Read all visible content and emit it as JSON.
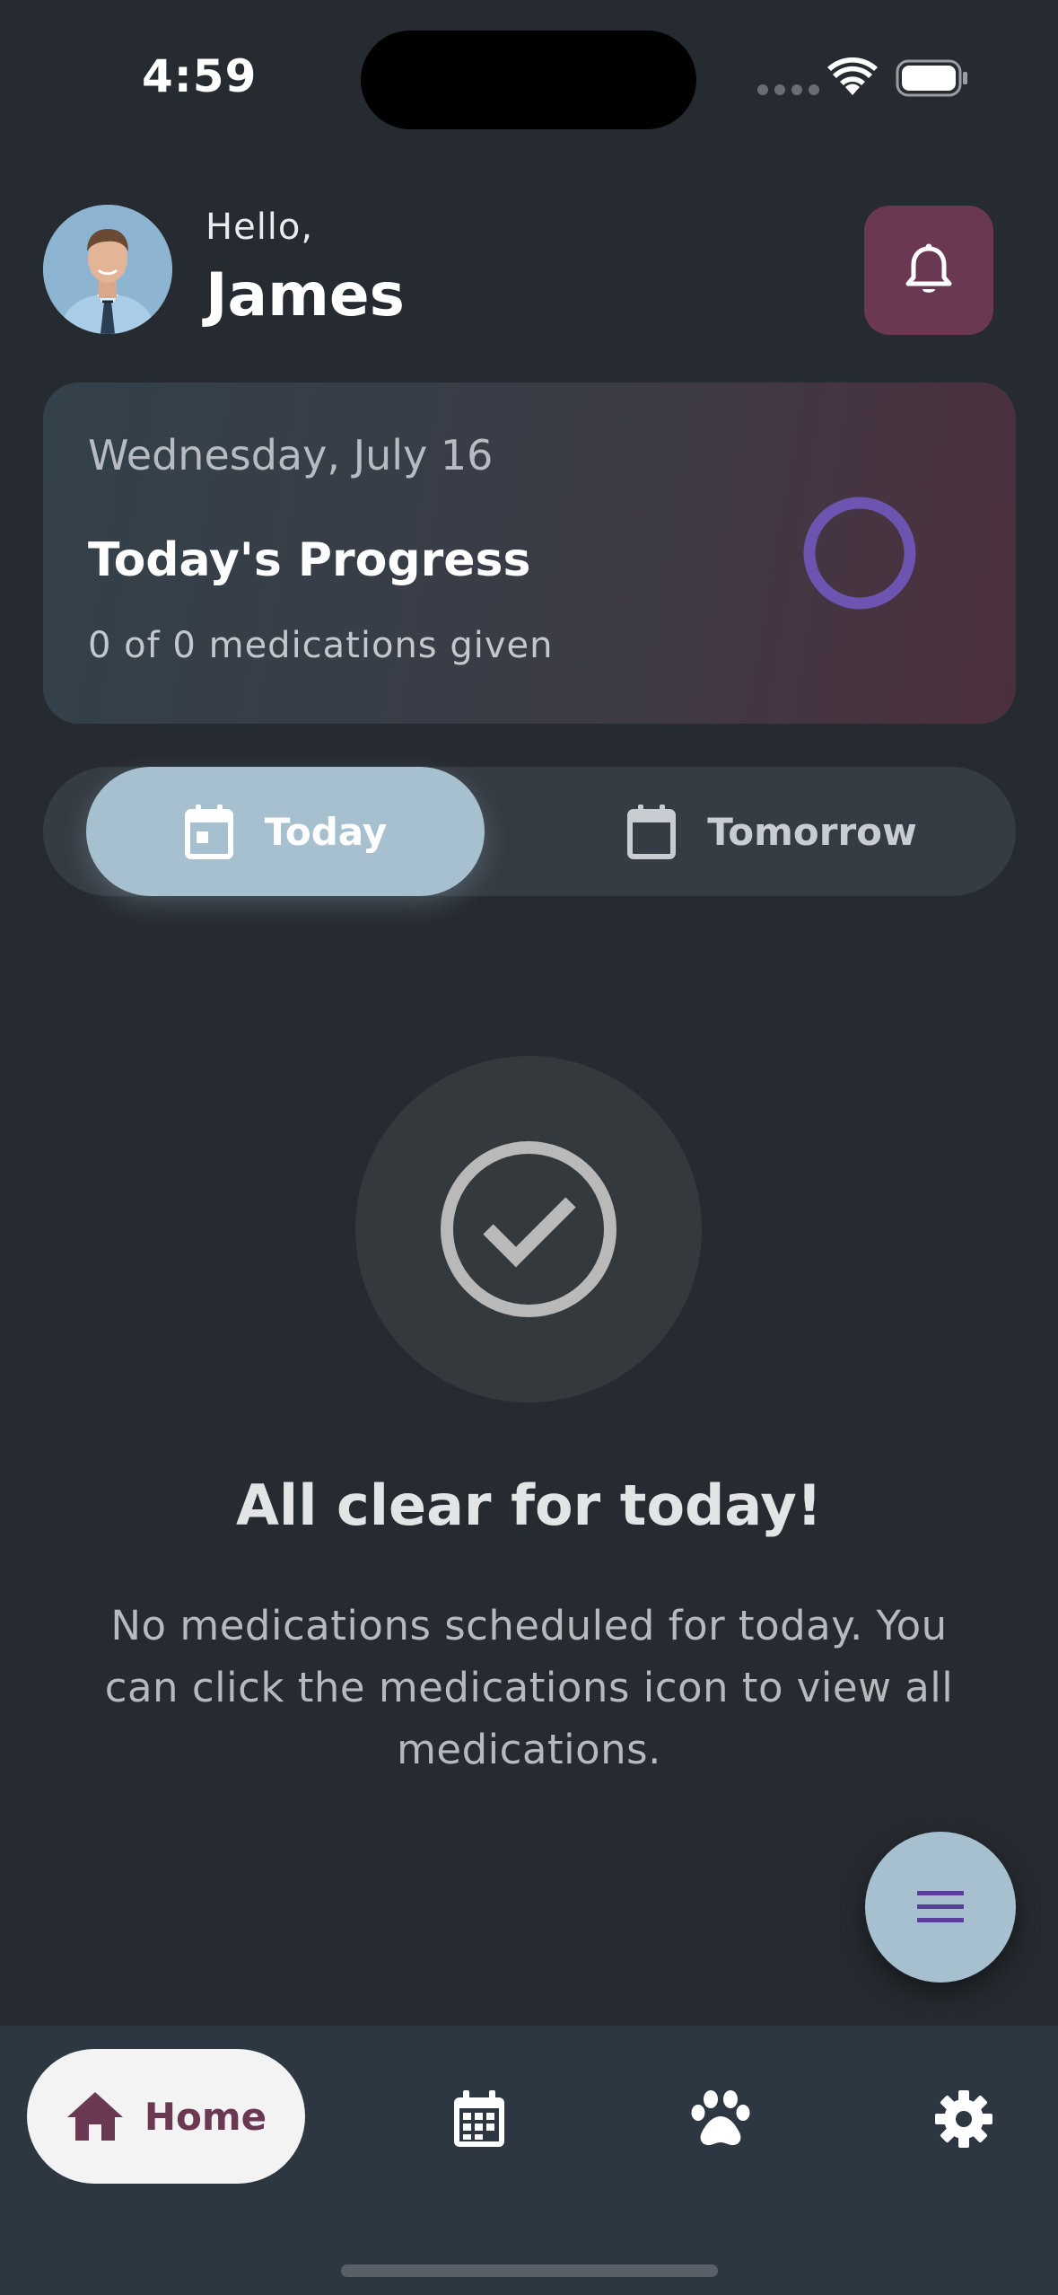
{
  "status_bar": {
    "time": "4:59"
  },
  "header": {
    "greeting": "Hello,",
    "user_name": "James",
    "avatar": "user-avatar",
    "notification_icon": "bell-icon"
  },
  "progress_card": {
    "date": "Wednesday, July 16",
    "title": "Today's Progress",
    "subtitle": "0 of 0 medications given",
    "given": 0,
    "total": 0
  },
  "day_toggle": {
    "selected": "Today",
    "options": [
      {
        "label": "Today",
        "icon": "calendar-today-icon"
      },
      {
        "label": "Tomorrow",
        "icon": "calendar-icon"
      }
    ]
  },
  "empty_state": {
    "icon": "check-circle-icon",
    "title": "All clear for today!",
    "description": "No medications scheduled for today. You can click the medications icon to view all medications."
  },
  "fab": {
    "icon": "menu-icon"
  },
  "bottom_nav": {
    "items": [
      {
        "label": "Home",
        "icon": "home-icon",
        "active": true
      },
      {
        "label": "",
        "icon": "calendar-grid-icon",
        "active": false
      },
      {
        "label": "",
        "icon": "paw-icon",
        "active": false
      },
      {
        "label": "",
        "icon": "gear-icon",
        "active": false
      }
    ]
  },
  "colors": {
    "background": "#262b31",
    "accent_maroon": "#6b3853",
    "accent_blue": "#a7c0d0",
    "ring_purple": "#6c54b0",
    "nav_background": "#2c3741"
  }
}
